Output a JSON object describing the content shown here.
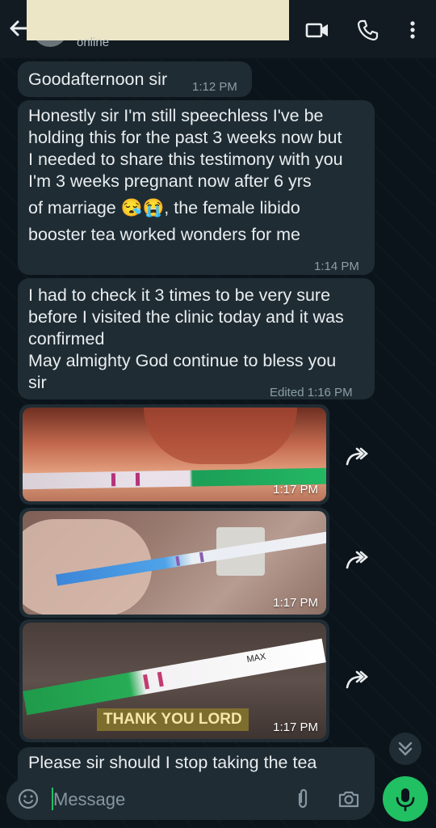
{
  "header": {
    "status": "online"
  },
  "messages": [
    {
      "text": "Goodafternoon sir",
      "time": "1:12 PM"
    },
    {
      "lines": [
        "Honestly sir I'm still speechless I've be",
        "holding this for the past 3 weeks now but",
        "I needed to share this testimony with you",
        "I'm 3 weeks pregnant now after 6 yrs"
      ],
      "line5_a": "of marriage",
      "emoji": "😪😭",
      "line5_b": ", the female libido",
      "line6": "booster tea worked wonders for me",
      "time": "1:14 PM"
    },
    {
      "lines": [
        "I had to check it 3 times to be very sure",
        "before I visited the clinic today and it was",
        "confirmed",
        "May almighty God continue to bless you",
        "sir"
      ],
      "time": "Edited 1:16 PM"
    },
    {
      "type": "photo",
      "time": "1:17 PM"
    },
    {
      "type": "photo",
      "time": "1:17 PM"
    },
    {
      "type": "photo",
      "time": "1:17 PM",
      "sticker": "THANK YOU LORD",
      "test_label": "MAX"
    },
    {
      "text": "Please sir should I stop taking the tea"
    }
  ],
  "composer": {
    "placeholder": "Message"
  },
  "colors": {
    "accent": "#21c063",
    "bubble": "#1f2c34",
    "background": "#0b141a"
  }
}
